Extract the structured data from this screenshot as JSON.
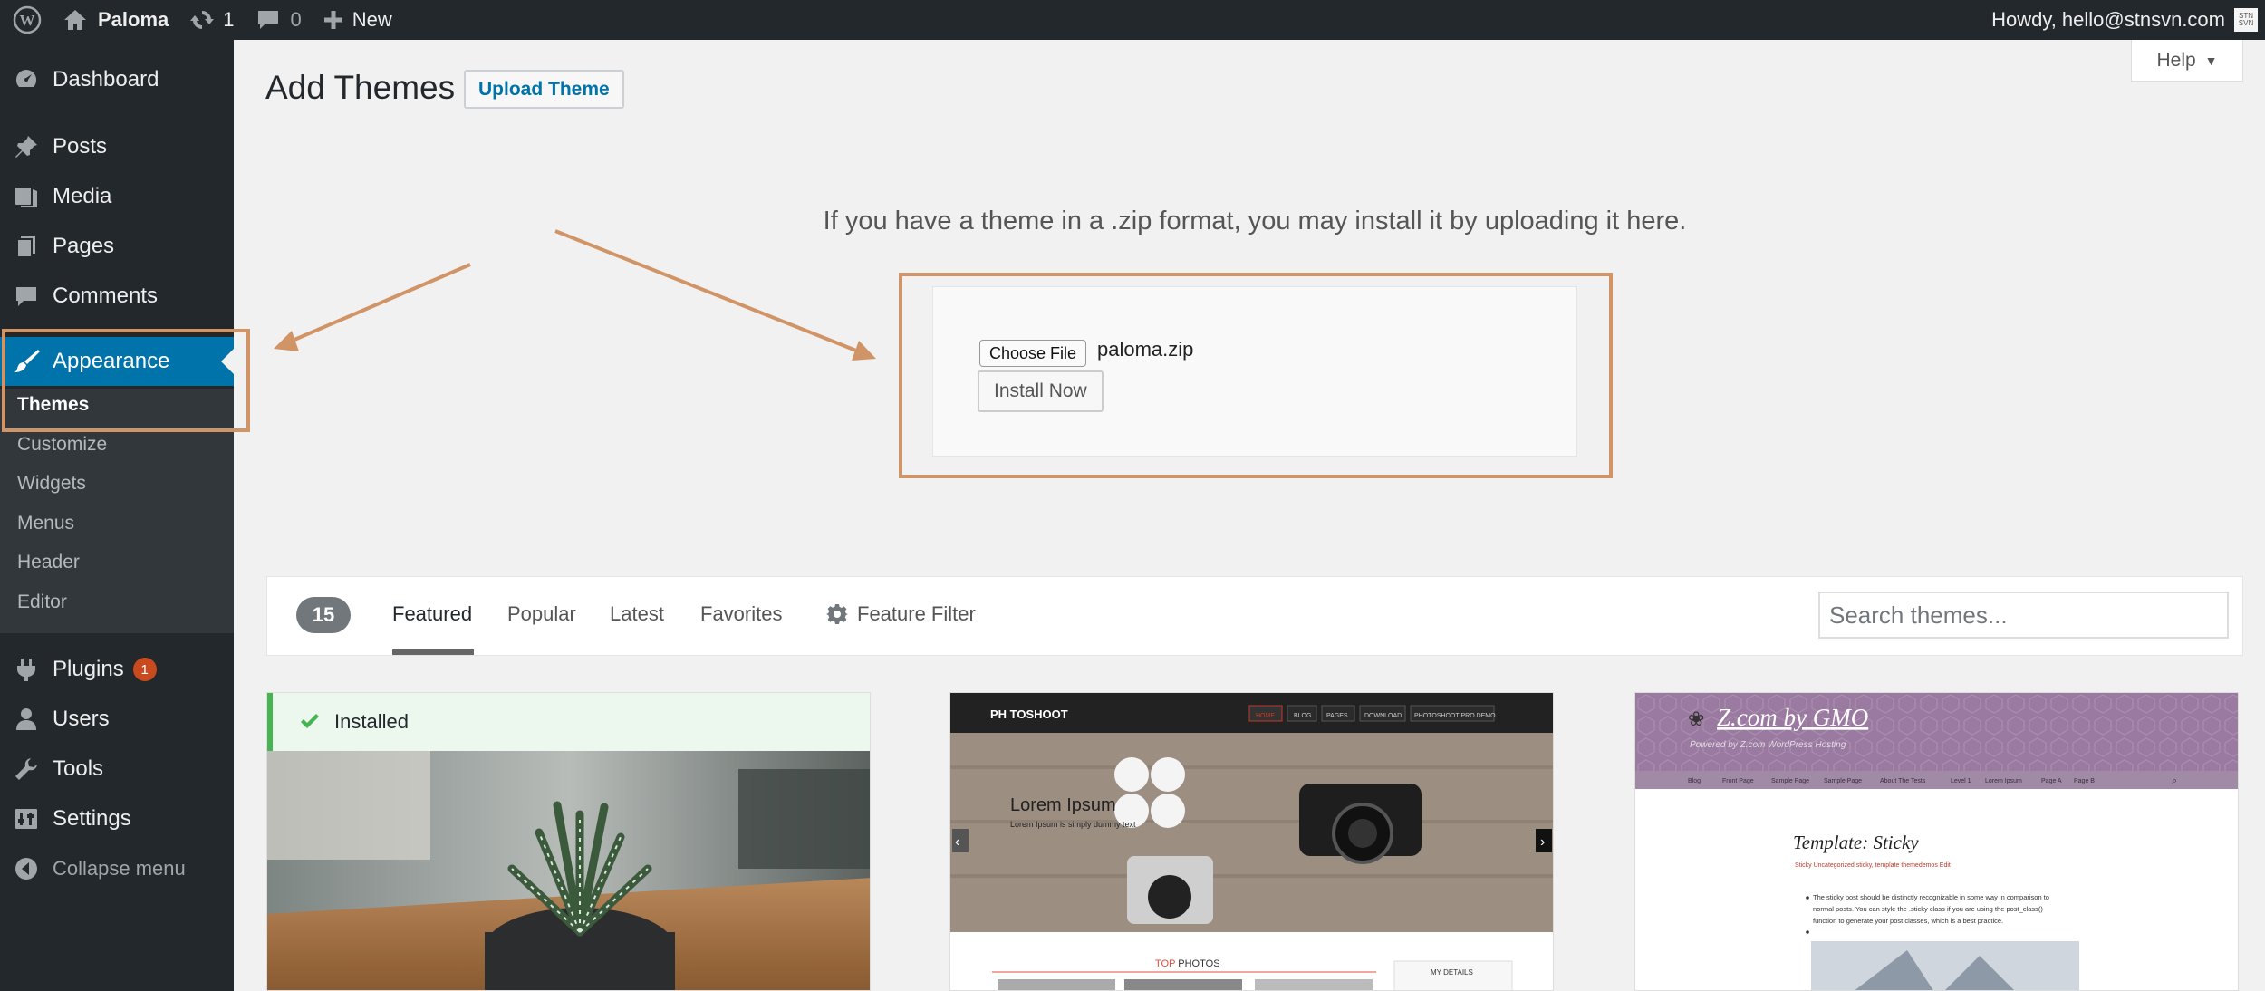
{
  "adminbar": {
    "site_name": "Paloma",
    "updates_count": "1",
    "comments_count": "0",
    "new_label": "New",
    "howdy": "Howdy, hello@stnsvn.com",
    "avatar_text": "STN SVN"
  },
  "sidebar": {
    "items": [
      {
        "label": "Dashboard",
        "icon": "dashboard-icon"
      },
      {
        "label": "Posts",
        "icon": "pushpin-icon"
      },
      {
        "label": "Media",
        "icon": "media-icon"
      },
      {
        "label": "Pages",
        "icon": "pages-icon"
      },
      {
        "label": "Comments",
        "icon": "comment-icon"
      },
      {
        "label": "Appearance",
        "icon": "paintbrush-icon"
      },
      {
        "label": "Plugins",
        "icon": "plugin-icon",
        "badge": "1"
      },
      {
        "label": "Users",
        "icon": "user-icon"
      },
      {
        "label": "Tools",
        "icon": "wrench-icon"
      },
      {
        "label": "Settings",
        "icon": "settings-icon"
      },
      {
        "label": "Collapse menu",
        "icon": "collapse-icon"
      }
    ],
    "submenu": [
      "Themes",
      "Customize",
      "Widgets",
      "Menus",
      "Header",
      "Editor"
    ]
  },
  "main": {
    "title": "Add Themes",
    "upload_theme_label": "Upload Theme",
    "help_label": "Help",
    "upload_description": "If you have a theme in a .zip format, you may install it by uploading it here.",
    "choose_file_label": "Choose File",
    "file_name": "paloma.zip",
    "install_now_label": "Install Now"
  },
  "filter_bar": {
    "count": "15",
    "links": [
      "Featured",
      "Popular",
      "Latest",
      "Favorites"
    ],
    "feature_filter_label": "Feature Filter",
    "search_placeholder": "Search themes..."
  },
  "themes": {
    "installed_label": "Installed",
    "photoshoot": {
      "brand": "PH TOSHOOT",
      "nav": [
        "HOME",
        "BLOG",
        "PAGES",
        "DOWNLOAD",
        "PHOTOSHOOT PRO DEMO"
      ],
      "hero_title": "Lorem Ipsum",
      "hero_sub": "Lorem Ipsum is simply dummy text",
      "top_photos_accent": "TOP",
      "top_photos_rest": " PHOTOS",
      "my_details": "MY DETAILS"
    },
    "zcom": {
      "title": "Z.com by GMO",
      "tagline": "Powered by Z.com WordPress Hosting",
      "nav": [
        "Blog",
        "Front Page",
        "Sample Page",
        "Sample Page",
        "About The Tests",
        "Level 1",
        "Lorem Ipsum",
        "Page A",
        "Page B"
      ],
      "post_title": "Template: Sticky",
      "meta": "Sticky  Uncategorized  sticky, template  themedemos  Edit",
      "excerpt1": "The sticky post should be distinctly recognizable in some way in comparison to",
      "excerpt2": "normal posts. You can style the .sticky class if you are using the post_class()",
      "excerpt3": "function to generate your post classes, which is a best practice."
    }
  },
  "colors": {
    "accent_blue": "#0073aa",
    "annotation_orange": "#d19466",
    "installed_green": "#46b450",
    "sidebar_dark": "#23282d"
  }
}
